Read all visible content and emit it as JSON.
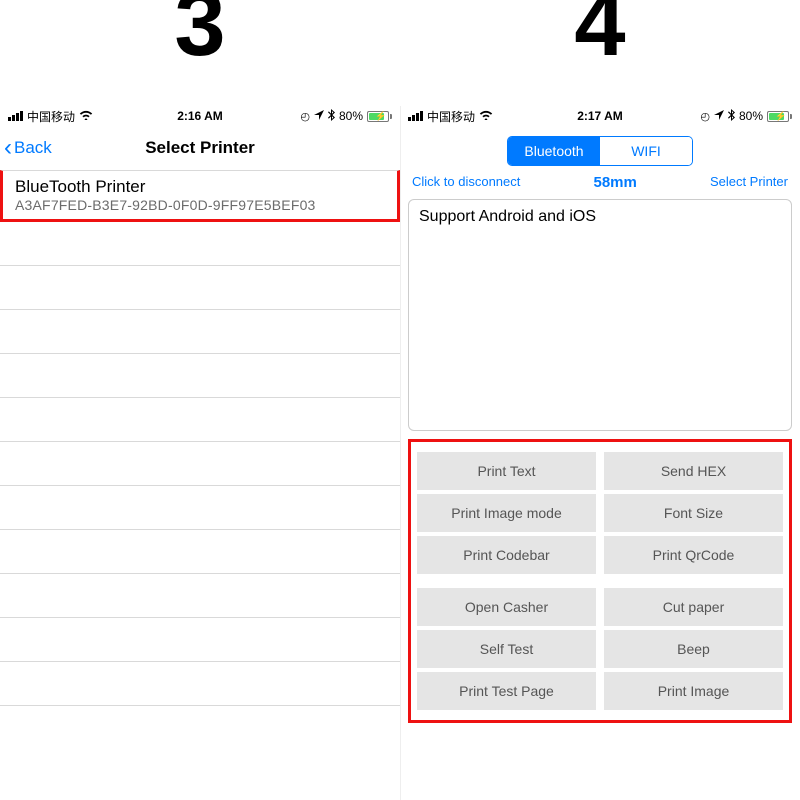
{
  "step_labels": {
    "left": "3",
    "right": "4"
  },
  "colors": {
    "accent": "#007aff",
    "highlight_box": "#e11",
    "battery": "#4cd964"
  },
  "screen3": {
    "status": {
      "carrier": "中国移动",
      "time": "2:16 AM",
      "batt_pct": "80%"
    },
    "nav": {
      "back": "Back",
      "title": "Select Printer"
    },
    "printer": {
      "name": "BlueTooth Printer",
      "id": "A3AF7FED-B3E7-92BD-0F0D-9FF97E5BEF03"
    }
  },
  "screen4": {
    "status": {
      "carrier": "中国移动",
      "time": "2:17 AM",
      "batt_pct": "80%"
    },
    "segmented": {
      "active": "Bluetooth",
      "inactive": "WIFI"
    },
    "toolbar": {
      "disconnect": "Click to disconnect",
      "size": "58mm",
      "select": "Select Printer"
    },
    "textbox": "Support Android and iOS",
    "buttons_top": [
      "Print Text",
      "Send HEX",
      "Print Image mode",
      "Font Size",
      "Print Codebar",
      "Print QrCode"
    ],
    "buttons_bottom": [
      "Open Casher",
      "Cut paper",
      "Self Test",
      "Beep",
      "Print Test Page",
      "Print Image"
    ]
  }
}
